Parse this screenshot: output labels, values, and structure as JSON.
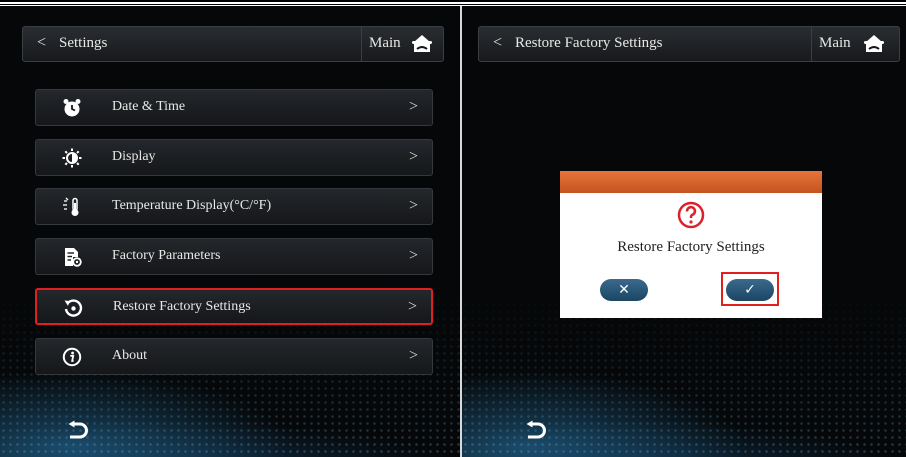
{
  "left_screen": {
    "header": {
      "title": "Settings",
      "main_label": "Main",
      "back_icon": "chevron-left-icon",
      "home_icon": "home-icon"
    },
    "menu": [
      {
        "label": "Date & Time",
        "icon": "alarm-clock-icon"
      },
      {
        "label": "Display",
        "icon": "brightness-icon"
      },
      {
        "label": "Temperature Display(°C/°F)",
        "icon": "thermometer-icon"
      },
      {
        "label": "Factory Parameters",
        "icon": "document-gear-icon"
      },
      {
        "label": "Restore Factory Settings",
        "icon": "restore-icon",
        "highlighted": true
      },
      {
        "label": "About",
        "icon": "info-icon"
      }
    ],
    "return_icon": "return-icon"
  },
  "right_screen": {
    "header": {
      "title": "Restore Factory Settings",
      "main_label": "Main",
      "back_icon": "chevron-left-icon",
      "home_icon": "home-icon"
    },
    "dialog": {
      "message": "Restore Factory Settings",
      "icon": "question-icon",
      "cancel_icon": "close-icon",
      "confirm_icon": "check-icon",
      "confirm_highlighted": true
    },
    "return_icon": "return-icon"
  },
  "glyphs": {
    "back": "<",
    "chevron": ">"
  },
  "colors": {
    "highlight": "#e02020",
    "dialog_bar": "#d9622b",
    "button": "#1f4a6a",
    "question": "#d9232a",
    "background": "#050708"
  }
}
